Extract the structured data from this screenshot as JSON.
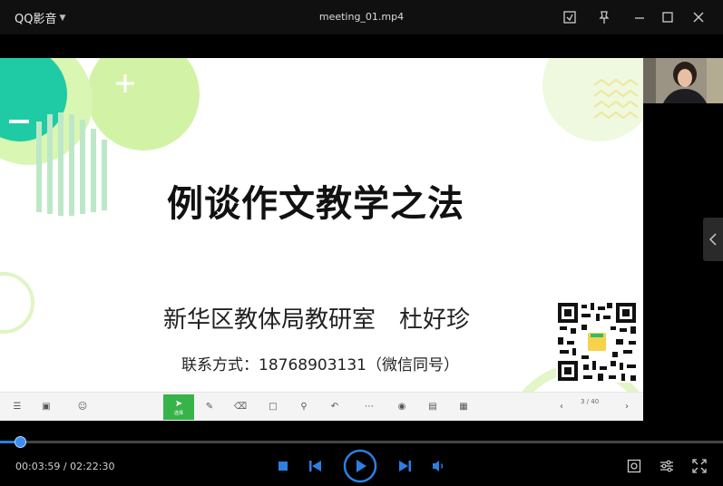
{
  "app": {
    "brand": "QQ影音",
    "file_title": "meeting_01.mp4"
  },
  "slide": {
    "title": "例谈作文教学之法",
    "subtitle": "新华区教体局教研室　杜好珍",
    "contact": "联系方式：18768903131（微信同号）"
  },
  "presentation_toolbar": {
    "page_indicator": "3 / 40",
    "active_tool": "选择"
  },
  "playback": {
    "current_time": "00:03:59",
    "total_time": "02:22:30",
    "time_text": "00:03:59 / 02:22:30",
    "progress_fraction": 0.028
  },
  "colors": {
    "accent": "#2d7fe0",
    "toolbar_active": "#38b34a",
    "slide_green": "#c6ef8c",
    "slide_teal": "#1fcba5"
  }
}
